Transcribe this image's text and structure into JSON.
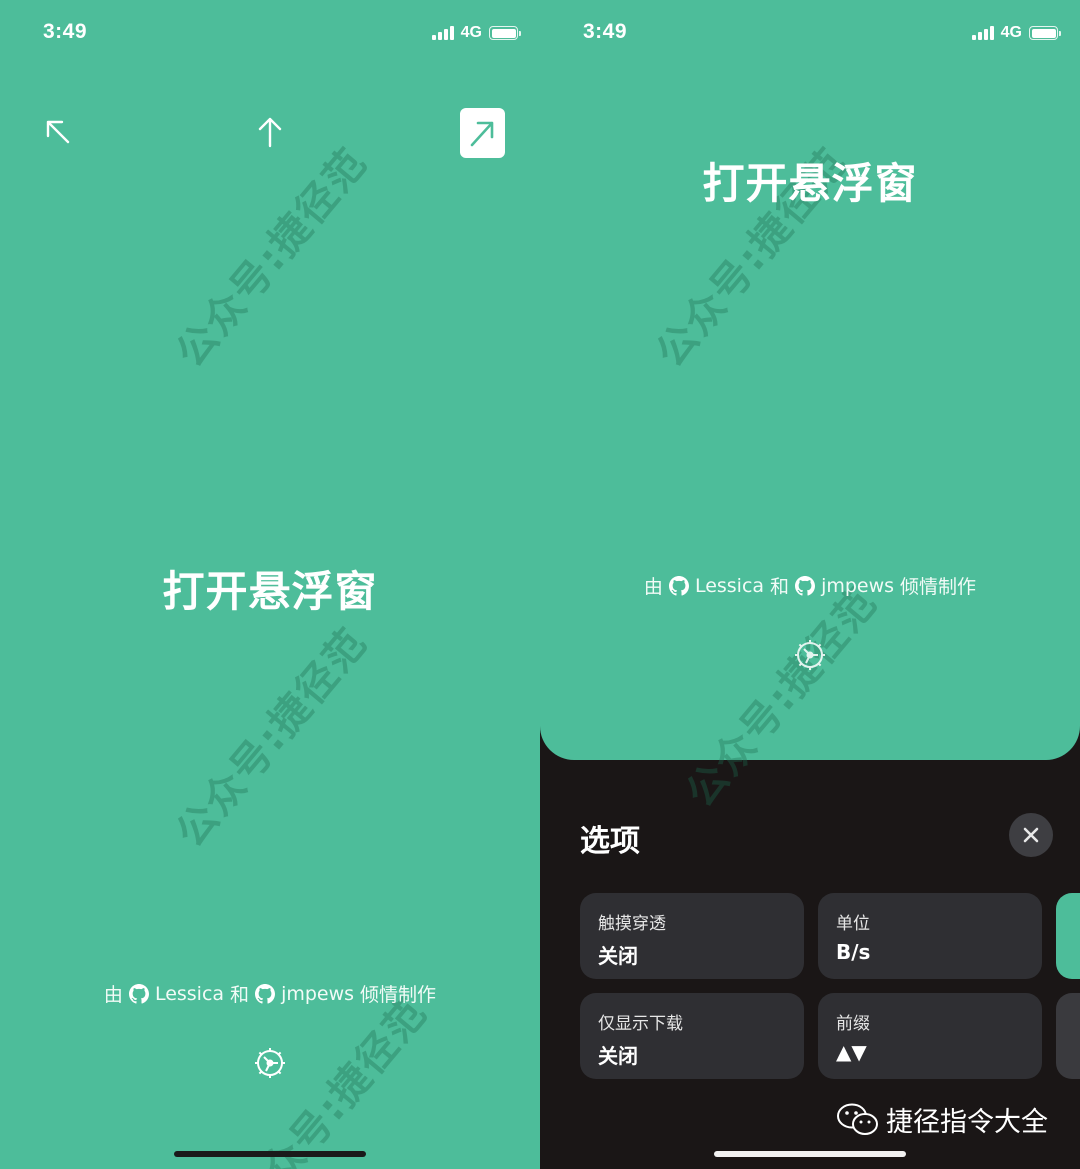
{
  "status": {
    "time": "3:49",
    "network": "4G"
  },
  "left": {
    "title": "打开悬浮窗",
    "credits": {
      "by": "由",
      "author1": "Lessica",
      "and": "和",
      "author2": "jmpews",
      "suffix": "倾情制作"
    },
    "watermark": "公众号:捷径范"
  },
  "right": {
    "title": "打开悬浮窗",
    "credits": {
      "by": "由",
      "author1": "Lessica",
      "and": "和",
      "author2": "jmpews",
      "suffix": "倾情制作"
    },
    "watermark": "公众号:捷径范",
    "options": {
      "title": "选项",
      "cards": [
        {
          "label": "触摸穿透",
          "value": "关闭"
        },
        {
          "label": "单位",
          "value": "B/s"
        },
        {
          "label": "仅显示下载",
          "value": "关闭"
        },
        {
          "label": "前缀",
          "value": "▲▼"
        }
      ]
    },
    "brand": "捷径指令大全"
  },
  "colors": {
    "accent": "#4dbd9a",
    "sheet": "#1a1616",
    "card": "#2f2f33"
  },
  "icons": [
    "arrow-up-left-icon",
    "arrow-up-icon",
    "arrow-up-right-icon",
    "github-icon",
    "gear-icon",
    "close-icon",
    "wechat-icon"
  ]
}
